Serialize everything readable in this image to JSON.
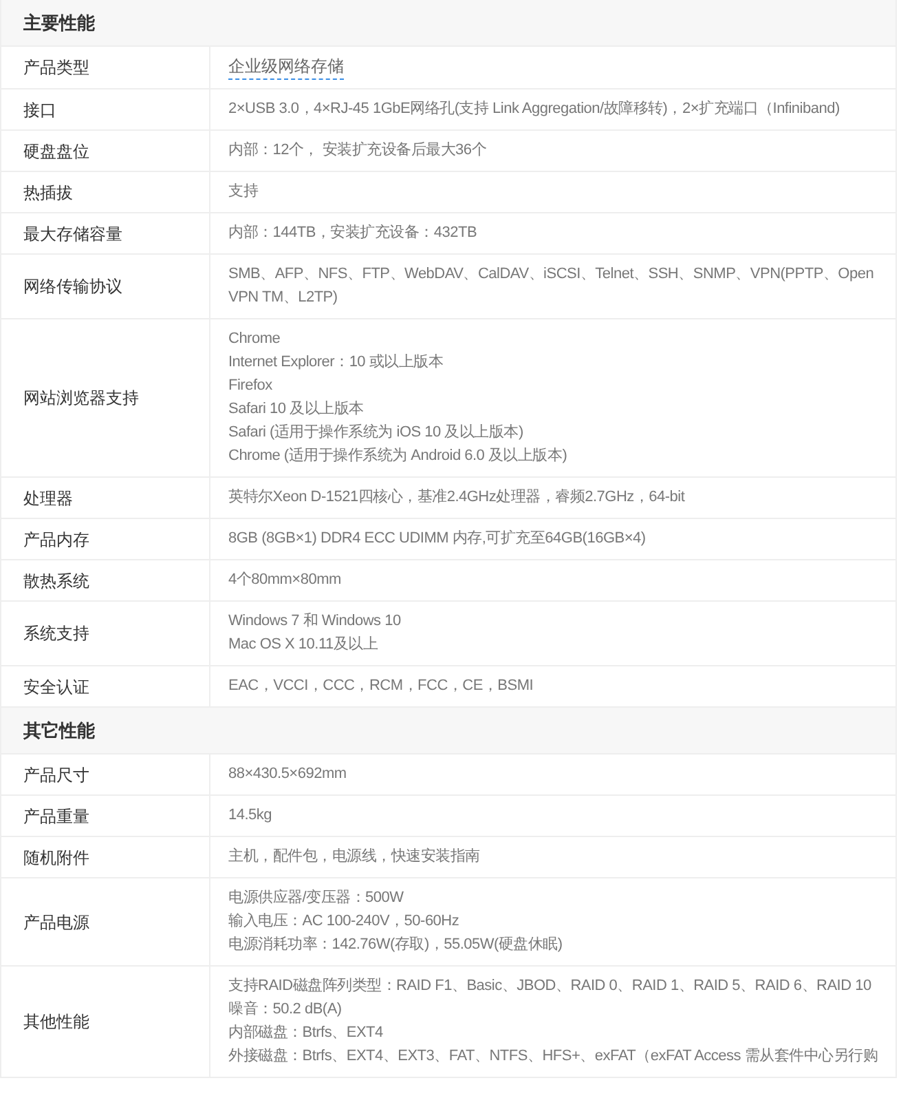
{
  "sections": [
    {
      "title": "主要性能",
      "rows": [
        {
          "label": "产品类型",
          "kind": "link",
          "lines": [
            "企业级网络存储"
          ]
        },
        {
          "label": "接口",
          "kind": "text",
          "lines": [
            "2×USB 3.0，4×RJ-45 1GbE网络孔(支持 Link Aggregation/故障移转)，2×扩充端口（Infiniband)"
          ]
        },
        {
          "label": "硬盘盘位",
          "kind": "text",
          "lines": [
            "内部：12个， 安装扩充设备后最大36个"
          ]
        },
        {
          "label": "热插拔",
          "kind": "text",
          "lines": [
            "支持"
          ]
        },
        {
          "label": "最大存储容量",
          "kind": "text",
          "lines": [
            "内部：144TB，安装扩充设备：432TB"
          ]
        },
        {
          "label": "网络传输协议",
          "kind": "text",
          "lines": [
            "SMB、AFP、NFS、FTP、WebDAV、CalDAV、iSCSI、Telnet、SSH、SNMP、VPN(PPTP、Open VPN TM、L2TP)"
          ]
        },
        {
          "label": "网站浏览器支持",
          "kind": "text",
          "lines": [
            "Chrome",
            "Internet Explorer：10 或以上版本",
            "Firefox",
            "Safari 10 及以上版本",
            "Safari (适用于操作系统为 iOS 10 及以上版本)",
            "Chrome (适用于操作系统为 Android 6.0 及以上版本)"
          ]
        },
        {
          "label": "处理器",
          "kind": "text",
          "lines": [
            "英特尔Xeon D-1521四核心，基准2.4GHz处理器，睿频2.7GHz，64-bit"
          ]
        },
        {
          "label": "产品内存",
          "kind": "text",
          "lines": [
            "8GB (8GB×1) DDR4 ECC UDIMM 内存,可扩充至64GB(16GB×4)"
          ]
        },
        {
          "label": "散热系统",
          "kind": "text",
          "lines": [
            "4个80mm×80mm"
          ]
        },
        {
          "label": "系统支持",
          "kind": "text",
          "lines": [
            "Windows 7 和 Windows 10",
            "Mac OS X 10.11及以上"
          ]
        },
        {
          "label": "安全认证",
          "kind": "text",
          "lines": [
            "EAC，VCCI，CCC，RCM，FCC，CE，BSMI"
          ]
        }
      ]
    },
    {
      "title": "其它性能",
      "rows": [
        {
          "label": "产品尺寸",
          "kind": "text",
          "lines": [
            "88×430.5×692mm"
          ]
        },
        {
          "label": "产品重量",
          "kind": "text",
          "lines": [
            "14.5kg"
          ]
        },
        {
          "label": "随机附件",
          "kind": "text",
          "lines": [
            "主机，配件包，电源线，快速安装指南"
          ]
        },
        {
          "label": "产品电源",
          "kind": "text",
          "lines": [
            "电源供应器/变压器：500W",
            "输入电压：AC 100-240V，50-60Hz",
            "电源消耗功率：142.76W(存取)，55.05W(硬盘休眠)"
          ]
        },
        {
          "label": "其他性能",
          "kind": "text",
          "lines": [
            "支持RAID磁盘阵列类型：RAID F1、Basic、JBOD、RAID 0、RAID 1、RAID 5、RAID 6、RAID 10",
            "噪音：50.2 dB(A)",
            "内部磁盘：Btrfs、EXT4",
            "外接磁盘：Btrfs、EXT4、EXT3、FAT、NTFS、HFS+、exFAT（exFAT Access 需从套件中心另行购"
          ]
        }
      ]
    }
  ]
}
